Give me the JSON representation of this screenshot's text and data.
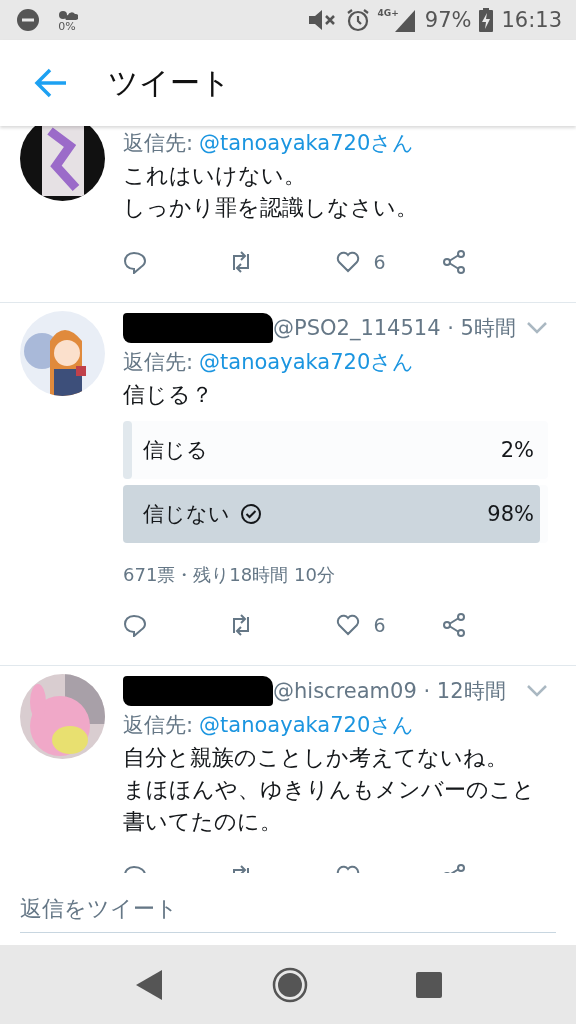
{
  "status_bar": {
    "weather_reading": "0%",
    "network": "4G+",
    "battery": "97%",
    "time": "16:13"
  },
  "header": {
    "title": "ツイート"
  },
  "tweets": [
    {
      "avatar": {
        "kind": "picture"
      },
      "reply_to_label": "返信先:",
      "reply_to": "@tanoayaka720さん",
      "lines": [
        "これはいけない。",
        "しっかり罪を認識しなさい。"
      ],
      "likes": "6"
    },
    {
      "redacted": true,
      "avatar": {
        "kind": "picture"
      },
      "meta": "@PSO2_114514 · 5時間",
      "reply_to_label": "返信先:",
      "reply_to": "@tanoayaka720さん",
      "lines": [
        "信じる？"
      ],
      "poll": {
        "options": [
          {
            "label": "信じる",
            "percent": "2%",
            "level": 0.02,
            "voted": false
          },
          {
            "label": "信じない",
            "percent": "98%",
            "level": 0.98,
            "voted": true
          }
        ],
        "footer": "671票・残り18時間 10分"
      },
      "likes": "6"
    },
    {
      "redacted": true,
      "avatar": {
        "kind": "picture"
      },
      "meta": "@hiscream09 · 12時間",
      "reply_to_label": "返信先:",
      "reply_to": "@tanoayaka720さん",
      "lines": [
        "自分と親族のことしか考えてないね。",
        "まほほんや、ゆきりんもメンバーのこと",
        "書いてたのに。"
      ]
    }
  ],
  "reply_field": {
    "placeholder": "返信をツイート"
  }
}
